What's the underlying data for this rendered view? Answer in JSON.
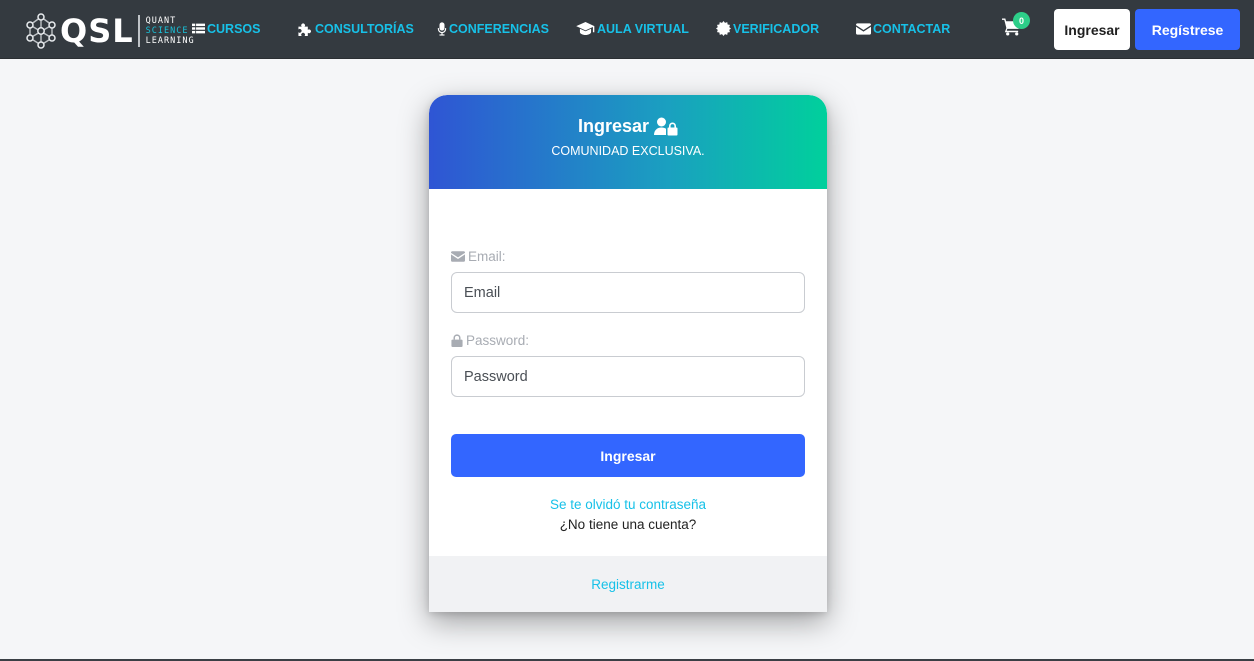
{
  "brand": {
    "logo_text": "QSL",
    "sub_line1": "QUANT",
    "sub_line2": "SCIENCE",
    "sub_line3": "LEARNING",
    "icon": "molecule-logo-icon"
  },
  "nav": {
    "items": [
      {
        "label": "CURSOS",
        "icon": "grid-icon"
      },
      {
        "label": "CONSULTORÍAS",
        "icon": "puzzle-icon"
      },
      {
        "label": "CONFERENCIAS",
        "icon": "microphone-icon"
      },
      {
        "label": "AULA VIRTUAL",
        "icon": "graduation-cap-icon"
      },
      {
        "label": "VERIFICADOR",
        "icon": "certificate-icon"
      },
      {
        "label": "CONTACTAR",
        "icon": "envelope-icon"
      }
    ],
    "cart_count": "0",
    "login_label": "Ingresar",
    "register_label": "Regístrese"
  },
  "login_card": {
    "title": "Ingresar",
    "title_icon": "user-lock-icon",
    "subtitle": "COMUNIDAD EXCLUSIVA.",
    "email_label": "Email:",
    "email_placeholder": "Email",
    "email_value": "",
    "password_label": "Password:",
    "password_placeholder": "Password",
    "password_value": "",
    "submit_label": "Ingresar",
    "forgot_password": "Se te olvidó tu contraseña",
    "no_account": "¿No tiene una cuenta?",
    "register_link": "Registrarme"
  },
  "colors": {
    "navbar_bg": "#343a40",
    "nav_link": "#17c1e8",
    "primary": "#3366ff",
    "badge": "#2dce89",
    "header_gradient_start": "#2f55d4",
    "header_gradient_end": "#00d09c",
    "page_bg": "#f5f6f8"
  }
}
